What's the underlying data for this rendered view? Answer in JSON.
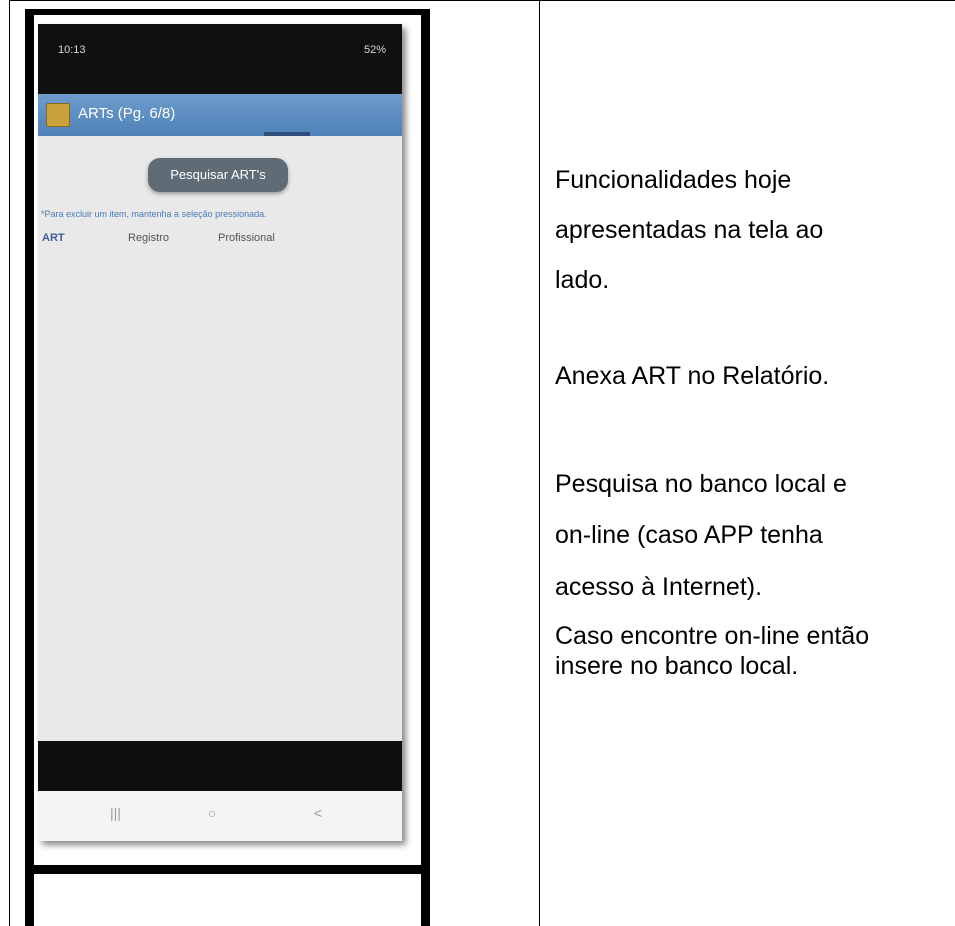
{
  "phone": {
    "status": {
      "time": "10:13",
      "right": "52%"
    },
    "app_title": "ARTs (Pg. 6/8)",
    "search_button": "Pesquisar ART's",
    "hint": "*Para excluir um item, mantenha a seleção pressionada.",
    "columns": [
      "ART",
      "Registro",
      "Profissional"
    ],
    "nav": {
      "recent": "|||",
      "home": "○",
      "back": "<"
    }
  },
  "description": {
    "lines": [
      "Funcionalidades hoje",
      "apresentadas na tela ao",
      "lado.",
      "Anexa ART no Relatório.",
      "Pesquisa no banco local e",
      "on-line (caso APP tenha",
      "acesso à Internet).",
      "Caso encontre on-line então",
      "insere no banco local."
    ]
  }
}
